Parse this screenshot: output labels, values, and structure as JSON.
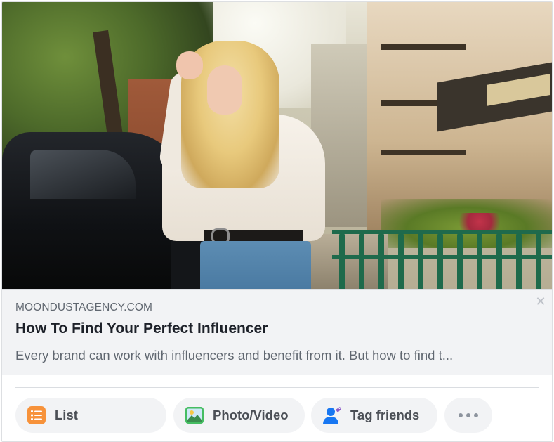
{
  "link_preview": {
    "domain": "MOONDUSTAGENCY.COM",
    "title": "How To Find Your Perfect Influencer",
    "description": "Every brand can work with influencers and benefit from it. But how to find t..."
  },
  "composer_actions": {
    "list_label": "List",
    "photo_video_label": "Photo/Video",
    "tag_friends_label": "Tag friends"
  },
  "icons": {
    "close": "close-icon",
    "list": "list-icon",
    "photo": "photo-icon",
    "tag": "tag-friends-icon",
    "more": "more-icon"
  },
  "colors": {
    "list_icon": "#f7923a",
    "photo_icon": "#45bd62",
    "tag_icon": "#1877f2"
  }
}
